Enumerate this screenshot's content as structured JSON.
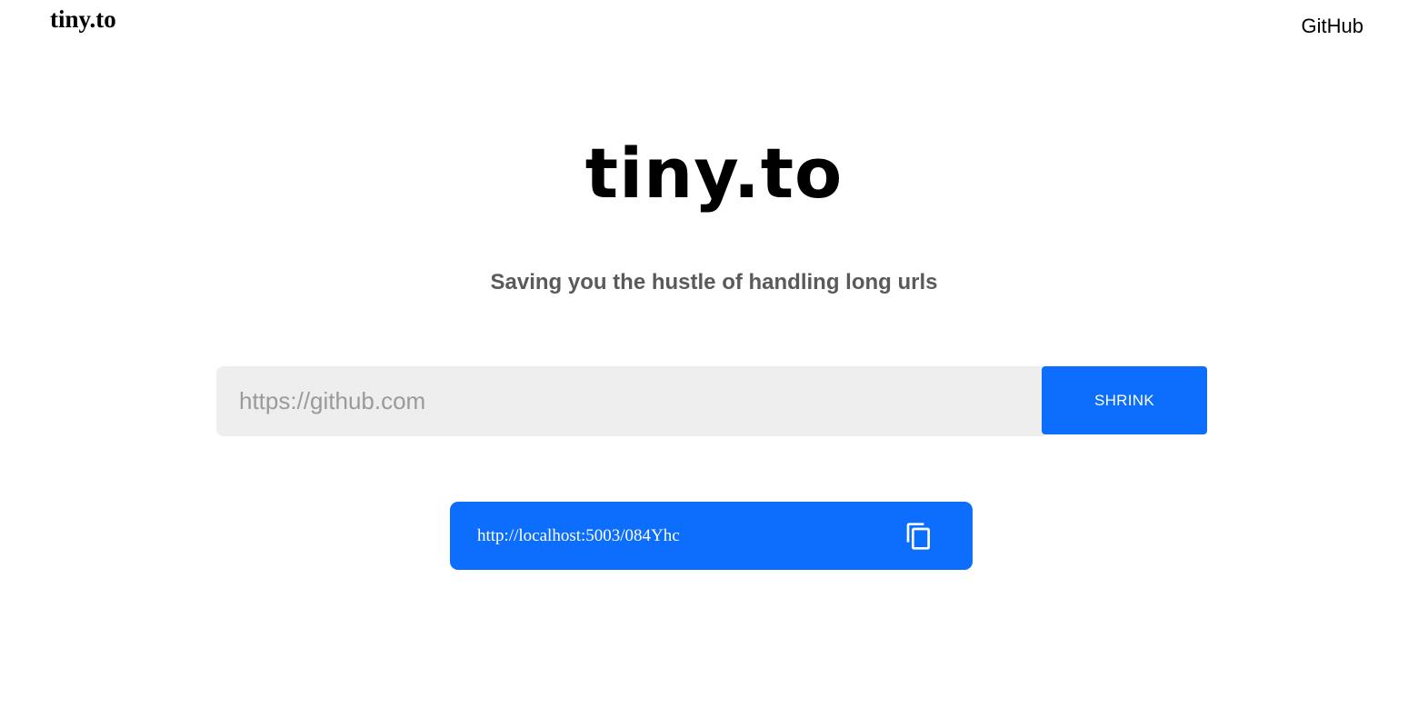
{
  "nav": {
    "brand": "tiny.to",
    "github_link": "GitHub"
  },
  "hero": {
    "logo": "tiny.to",
    "tagline": "Saving you the hustle of handling long urls"
  },
  "form": {
    "input_placeholder": "https://github.com",
    "input_value": "",
    "submit_label": "SHRINK"
  },
  "result": {
    "short_url": "http://localhost:5003/084Yhc",
    "copy_icon": "copy-icon"
  },
  "colors": {
    "accent": "#0d6efd",
    "input_bg": "#eeeeee",
    "tagline": "#5a5a5a"
  }
}
